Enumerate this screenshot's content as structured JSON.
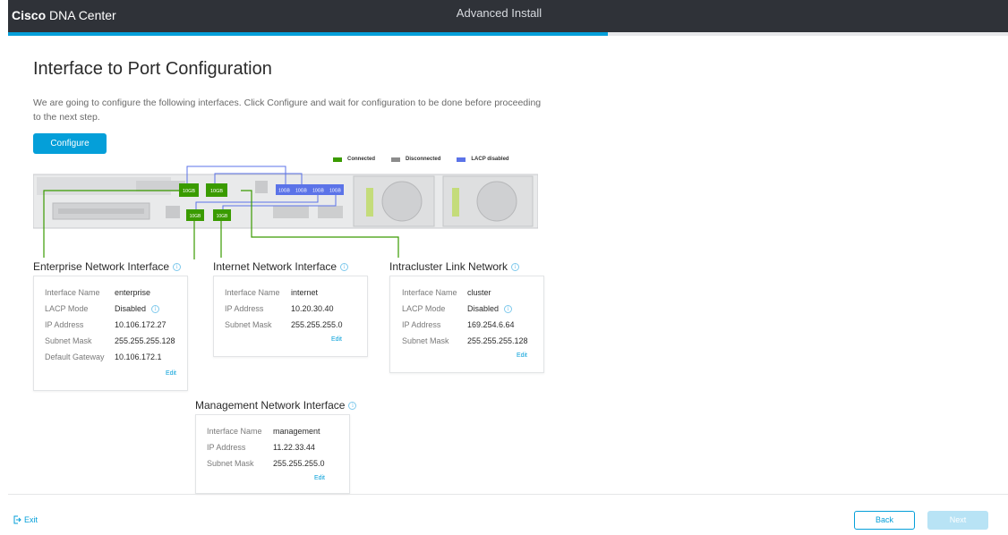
{
  "header": {
    "brand_bold": "Cisco",
    "brand_rest": " DNA Center",
    "wizard_title": "Advanced Install",
    "progress_percent": 60
  },
  "page": {
    "title": "Interface to Port Configuration",
    "description": "We are going to configure the following interfaces. Click Configure and wait for configuration to be done before proceeding to the next step.",
    "configure_label": "Configure"
  },
  "legend": {
    "connected": "Connected",
    "disconnected": "Disconnected",
    "lacp_disabled": "LACP disabled",
    "colors": {
      "connected": "#3a9b00",
      "disconnected": "#8c8c8c",
      "lacp_disabled": "#5b73e8"
    }
  },
  "ports": {
    "label": "10GB"
  },
  "interfaces": {
    "enterprise": {
      "title": "Enterprise Network Interface",
      "name_label": "Interface Name",
      "name_value": "enterprise",
      "lacp_label": "LACP Mode",
      "lacp_value": "Disabled",
      "ip_label": "IP Address",
      "ip_value": "10.106.172.27",
      "mask_label": "Subnet Mask",
      "mask_value": "255.255.255.128",
      "gateway_label": "Default Gateway",
      "gateway_value": "10.106.172.1",
      "edit_label": "Edit"
    },
    "internet": {
      "title": "Internet Network Interface",
      "name_label": "Interface Name",
      "name_value": "internet",
      "ip_label": "IP Address",
      "ip_value": "10.20.30.40",
      "mask_label": "Subnet Mask",
      "mask_value": "255.255.255.0",
      "edit_label": "Edit"
    },
    "cluster": {
      "title": "Intracluster Link Network",
      "name_label": "Interface Name",
      "name_value": "cluster",
      "lacp_label": "LACP Mode",
      "lacp_value": "Disabled",
      "ip_label": "IP Address",
      "ip_value": "169.254.6.64",
      "mask_label": "Subnet Mask",
      "mask_value": "255.255.255.128",
      "edit_label": "Edit"
    },
    "management": {
      "title": "Management Network Interface",
      "name_label": "Interface Name",
      "name_value": "management",
      "ip_label": "IP Address",
      "ip_value": "11.22.33.44",
      "mask_label": "Subnet Mask",
      "mask_value": "255.255.255.0",
      "edit_label": "Edit"
    }
  },
  "footer": {
    "exit_label": "Exit",
    "back_label": "Back",
    "next_label": "Next"
  }
}
